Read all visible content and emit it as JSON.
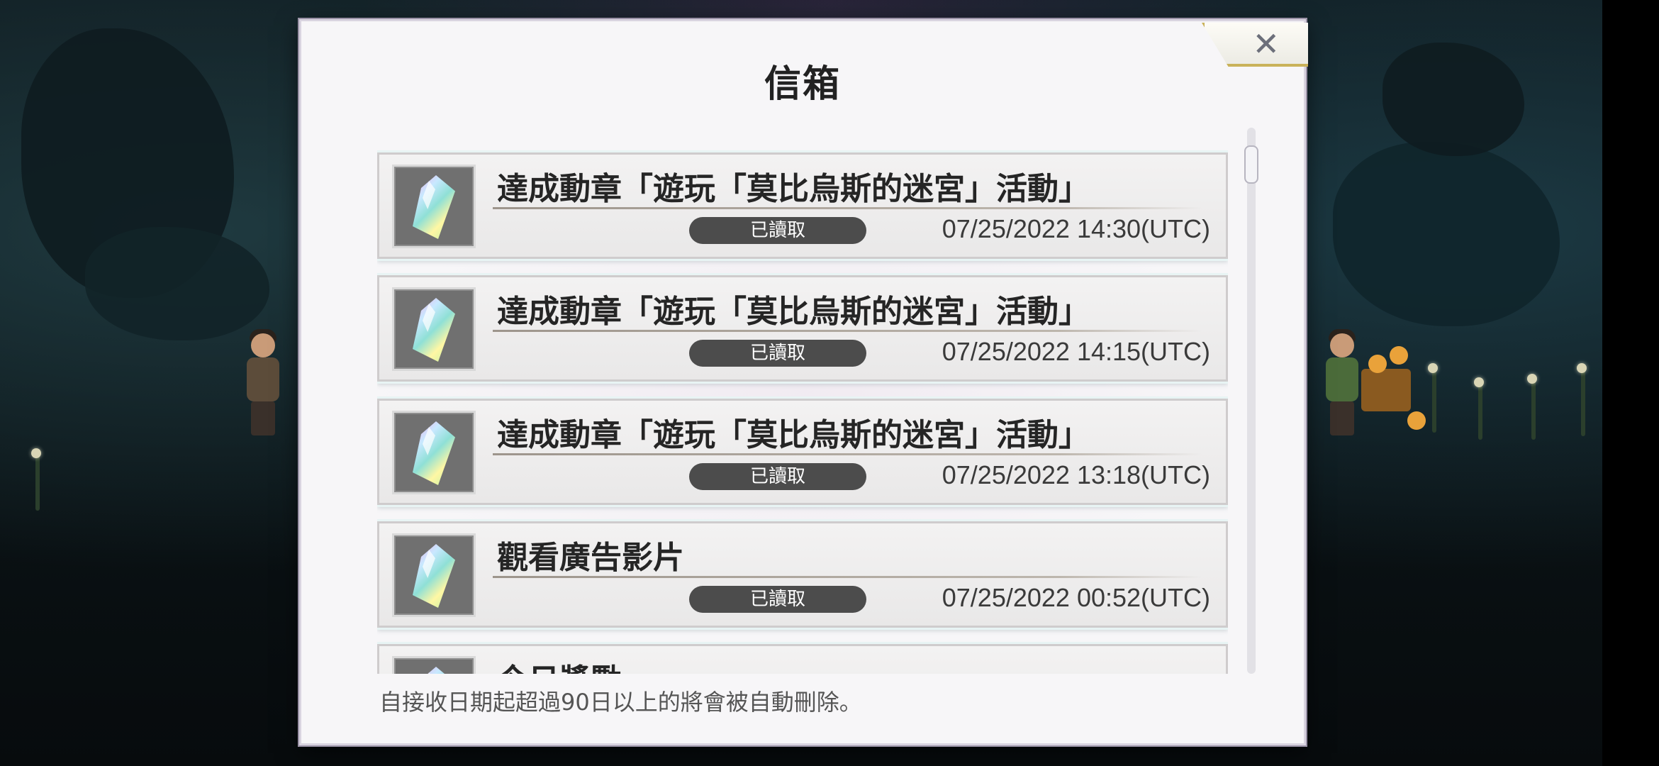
{
  "dialog": {
    "title": "信箱",
    "close_icon": "close-icon",
    "footer_note": "自接收日期起超過90日以上的將會被自動刪除。"
  },
  "mails": [
    {
      "title": "達成動章「遊玩「莫比烏斯的迷宮」活動」",
      "status": "已讀取",
      "date": "07/25/2022 14:30(UTC)",
      "icon": "crystal-icon"
    },
    {
      "title": "達成動章「遊玩「莫比烏斯的迷宮」活動」",
      "status": "已讀取",
      "date": "07/25/2022 14:15(UTC)",
      "icon": "crystal-icon"
    },
    {
      "title": "達成動章「遊玩「莫比烏斯的迷宮」活動」",
      "status": "已讀取",
      "date": "07/25/2022 13:18(UTC)",
      "icon": "crystal-icon"
    },
    {
      "title": "觀看廣告影片",
      "status": "已讀取",
      "date": "07/25/2022 00:52(UTC)",
      "icon": "crystal-icon"
    },
    {
      "title": "今日獎勵",
      "status": "",
      "date": "",
      "icon": "crystal-icon"
    }
  ],
  "colors": {
    "badge": "#4c4c4c",
    "close_border": "#c9b25a",
    "panel": "#f7f6f8"
  }
}
